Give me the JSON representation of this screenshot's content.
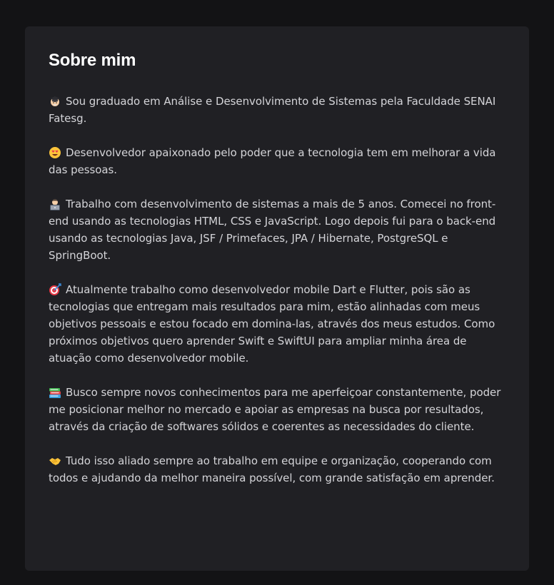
{
  "about": {
    "title": "Sobre mim",
    "paragraphs": [
      {
        "icon": "graduate-icon",
        "text": "Sou graduado em Análise e Desenvolvimento de Sistemas pela Faculdade SENAI Fatesg."
      },
      {
        "icon": "heart-eyes-icon",
        "text": "Desenvolvedor apaixonado pelo poder que a tecnologia tem em melhorar a vida das pessoas."
      },
      {
        "icon": "technologist-icon",
        "text": "Trabalho com desenvolvimento de sistemas a mais de 5 anos. Comecei no front-end usando as tecnologias HTML, CSS e JavaScript. Logo depois fui para o back-end usando as tecnologias Java, JSF / Primefaces, JPA / Hibernate, PostgreSQL e SpringBoot."
      },
      {
        "icon": "target-icon",
        "text": "Atualmente trabalho como desenvolvedor mobile Dart e Flutter, pois são as tecnologias que entregam mais resultados para mim, estão alinhadas com meus objetivos pessoais e estou focado em domina-las, através dos meus estudos. Como próximos objetivos quero aprender Swift e SwiftUI para ampliar minha área de atuação como desenvolvedor mobile."
      },
      {
        "icon": "books-icon",
        "text": "Busco sempre novos conhecimentos para me aperfeiçoar constantemente, poder me posicionar melhor no mercado e apoiar as empresas na busca por resultados, através da criação de softwares sólidos e coerentes as necessidades do cliente."
      },
      {
        "icon": "handshake-icon",
        "text": "Tudo isso aliado sempre ao trabalho em equipe e organização, cooperando com todos e ajudando da melhor maneira possível, com grande satisfação em aprender."
      }
    ]
  }
}
